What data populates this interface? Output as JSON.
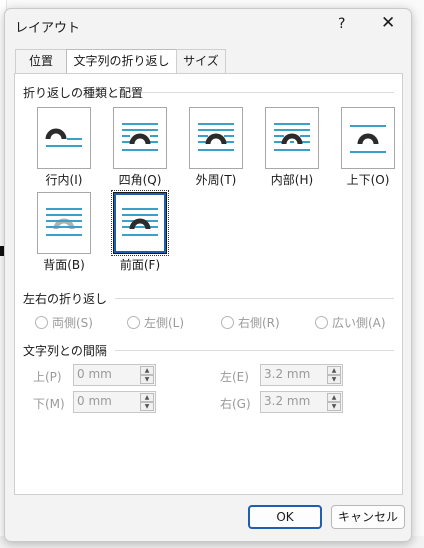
{
  "dialog": {
    "title": "レイアウト",
    "help": "?",
    "close": "✕"
  },
  "tabs": [
    {
      "label": "位置",
      "active": false
    },
    {
      "label": "文字列の折り返し",
      "active": true
    },
    {
      "label": "サイズ",
      "active": false
    }
  ],
  "wrapping": {
    "heading": "折り返しの種類と配置",
    "options": [
      {
        "label": "行内(I)",
        "icon": "inline-icon",
        "selected": false
      },
      {
        "label": "四角(Q)",
        "icon": "square-icon",
        "selected": false
      },
      {
        "label": "外周(T)",
        "icon": "tight-icon",
        "selected": false
      },
      {
        "label": "内部(H)",
        "icon": "through-icon",
        "selected": false
      },
      {
        "label": "上下(O)",
        "icon": "top-bottom-icon",
        "selected": false
      },
      {
        "label": "背面(B)",
        "icon": "behind-text-icon",
        "selected": false
      },
      {
        "label": "前面(F)",
        "icon": "in-front-of-text-icon",
        "selected": true
      }
    ]
  },
  "wrap_text": {
    "heading": "左右の折り返し",
    "options": [
      "両側(S)",
      "左側(L)",
      "右側(R)",
      "広い側(A)"
    ]
  },
  "distance": {
    "heading": "文字列との間隔",
    "top": {
      "label": "上(P)",
      "value": "0 mm"
    },
    "bottom": {
      "label": "下(M)",
      "value": "0 mm"
    },
    "left": {
      "label": "左(E)",
      "value": "3.2 mm"
    },
    "right": {
      "label": "右(G)",
      "value": "3.2 mm"
    }
  },
  "buttons": {
    "ok": "OK",
    "cancel": "キャンセル"
  },
  "colors": {
    "line": "#3aa0c8",
    "arch": "#2b2b2b",
    "focus": "#1f5fb0"
  }
}
